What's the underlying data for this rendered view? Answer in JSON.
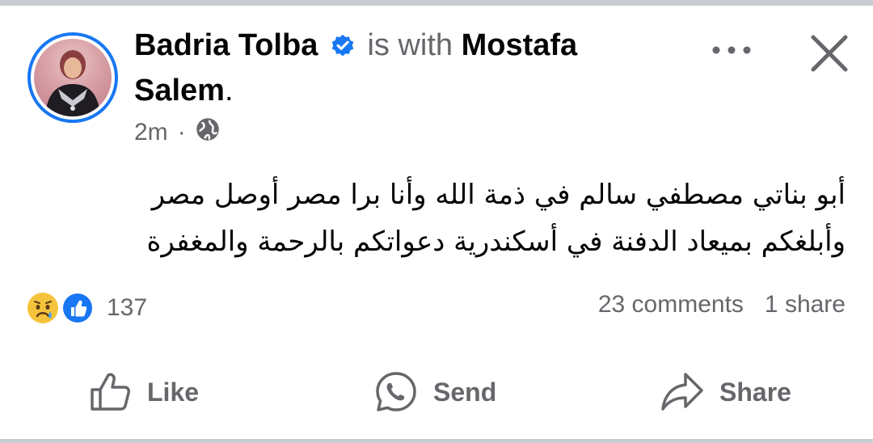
{
  "post": {
    "author": "Badria Tolba",
    "with_text": "is with",
    "tagged": "Mostafa",
    "tagged_rest": "Salem",
    "period": ".",
    "time": "2m",
    "separator": "·",
    "privacy_icon": "globe-icon",
    "text_lines": [
      "أبو بناتي مصطفي سالم في ذمة الله وأنا برا مصر أوصل مصر",
      "وأبلغكم بميعاد الدفنة في أسكندرية دعواتكم بالرحمة والمغفرة"
    ]
  },
  "reactions": {
    "icons": [
      "sad-reaction-icon",
      "like-reaction-icon"
    ],
    "count": "137",
    "comments": "23 comments",
    "shares": "1 share"
  },
  "actions": {
    "like": "Like",
    "send": "Send",
    "share": "Share"
  },
  "colors": {
    "accent": "#1877f2",
    "text": "#050505",
    "secondary": "#65676b"
  }
}
